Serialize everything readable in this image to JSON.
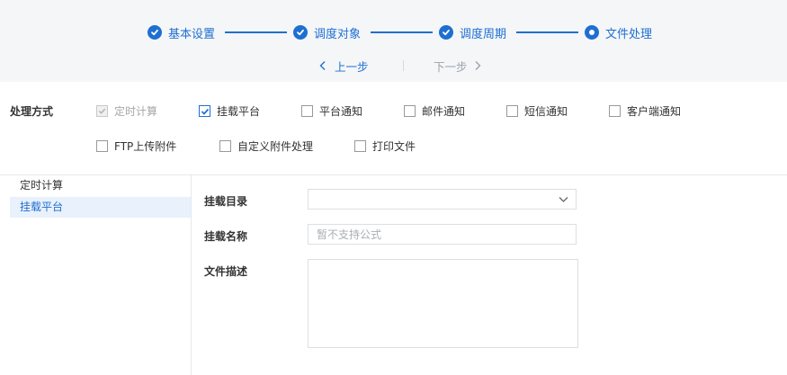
{
  "colors": {
    "primary": "#1f6fd1",
    "header_bg": "#f4f6f8",
    "active_item_bg": "#e9f1fc",
    "disabled_text": "#a6a6a6"
  },
  "steps": [
    {
      "label": "基本设置",
      "status": "completed",
      "icon": "check-icon"
    },
    {
      "label": "调度对象",
      "status": "completed",
      "icon": "check-icon"
    },
    {
      "label": "调度周期",
      "status": "completed",
      "icon": "check-icon"
    },
    {
      "label": "文件处理",
      "status": "current",
      "icon": "dot-icon"
    }
  ],
  "nav": {
    "prev_label": "上一步",
    "next_label": "下一步"
  },
  "processing": {
    "label": "处理方式",
    "options": [
      {
        "label": "定时计算",
        "checked": true,
        "disabled": true
      },
      {
        "label": "挂载平台",
        "checked": true,
        "disabled": false
      },
      {
        "label": "平台通知",
        "checked": false,
        "disabled": false
      },
      {
        "label": "邮件通知",
        "checked": false,
        "disabled": false
      },
      {
        "label": "短信通知",
        "checked": false,
        "disabled": false
      },
      {
        "label": "客户端通知",
        "checked": false,
        "disabled": false
      },
      {
        "label": "FTP上传附件",
        "checked": false,
        "disabled": false
      },
      {
        "label": "自定义附件处理",
        "checked": false,
        "disabled": false
      },
      {
        "label": "打印文件",
        "checked": false,
        "disabled": false
      }
    ]
  },
  "sidebar": {
    "items": [
      {
        "label": "定时计算",
        "active": false
      },
      {
        "label": "挂载平台",
        "active": true
      }
    ]
  },
  "form": {
    "mount_dir": {
      "label": "挂载目录",
      "value": ""
    },
    "mount_name": {
      "label": "挂载名称",
      "value": "",
      "placeholder": "暂不支持公式"
    },
    "file_desc": {
      "label": "文件描述",
      "value": ""
    }
  }
}
